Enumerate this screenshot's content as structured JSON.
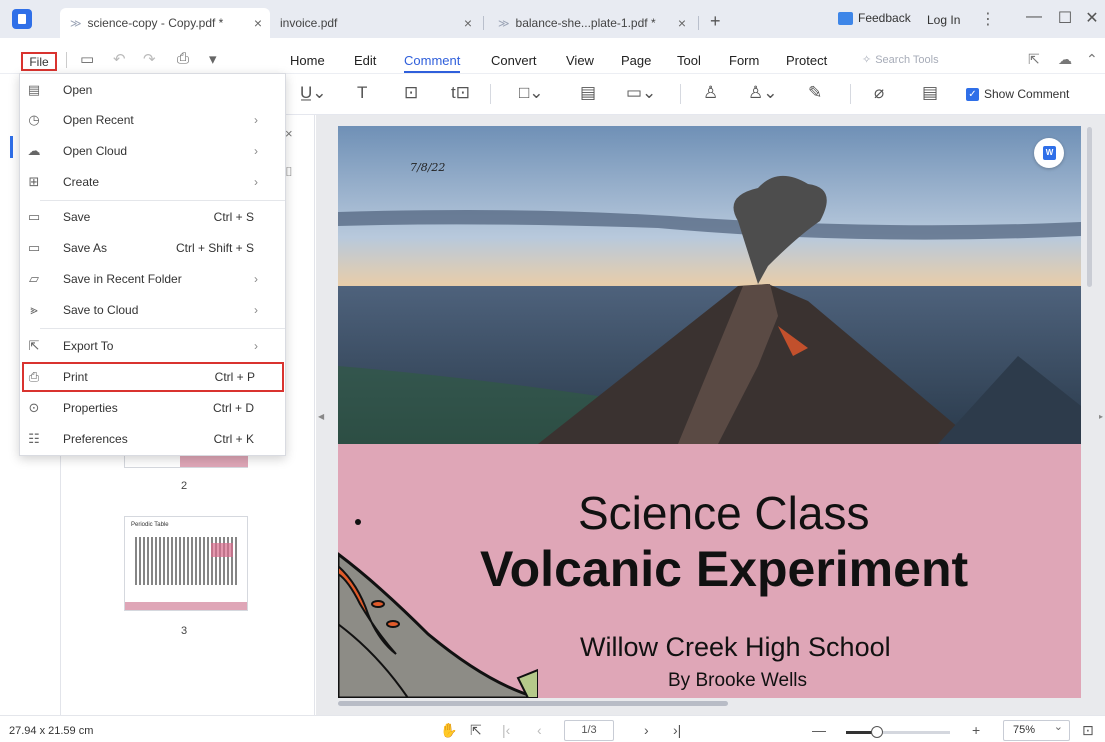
{
  "tabs": [
    {
      "label": "science-copy - Copy.pdf *",
      "close": "×"
    },
    {
      "label": "invoice.pdf",
      "close": "×"
    },
    {
      "label": "balance-she...plate-1.pdf *",
      "close": "×"
    }
  ],
  "tab_add": "+",
  "header": {
    "feedback": "Feedback",
    "login": "Log In",
    "kebab": "⋮",
    "minimize": "—",
    "maximize": "☐",
    "close": "✕"
  },
  "menu": {
    "file": "File",
    "items": [
      "Home",
      "Edit",
      "Comment",
      "Convert",
      "View",
      "Page",
      "Tool",
      "Form",
      "Protect"
    ],
    "active": "Comment",
    "search_placeholder": "Search Tools"
  },
  "toolbar": {
    "show_comment": "Show Comment",
    "show_comment_checked": true
  },
  "file_menu": [
    {
      "label": "Open",
      "shortcut": "",
      "arrow": false,
      "icon": "open-file-icon"
    },
    {
      "label": "Open Recent",
      "shortcut": "",
      "arrow": true,
      "icon": "clock-icon"
    },
    {
      "label": "Open Cloud",
      "shortcut": "",
      "arrow": true,
      "icon": "cloud-icon"
    },
    {
      "label": "Create",
      "shortcut": "",
      "arrow": true,
      "icon": "create-icon"
    },
    {
      "label": "Save",
      "shortcut": "Ctrl + S",
      "arrow": false,
      "icon": "save-icon"
    },
    {
      "label": "Save As",
      "shortcut": "Ctrl + Shift + S",
      "arrow": false,
      "icon": "save-as-icon"
    },
    {
      "label": "Save in Recent Folder",
      "shortcut": "",
      "arrow": true,
      "icon": "folder-icon"
    },
    {
      "label": "Save to Cloud",
      "shortcut": "",
      "arrow": true,
      "icon": "cloud-upload-icon"
    },
    {
      "label": "Export To",
      "shortcut": "",
      "arrow": true,
      "icon": "export-icon"
    },
    {
      "label": "Print",
      "shortcut": "Ctrl + P",
      "arrow": false,
      "icon": "printer-icon"
    },
    {
      "label": "Properties",
      "shortcut": "Ctrl + D",
      "arrow": false,
      "icon": "properties-icon"
    },
    {
      "label": "Preferences",
      "shortcut": "Ctrl + K",
      "arrow": false,
      "icon": "preferences-icon"
    }
  ],
  "thumbnails": {
    "page2": "2",
    "page3": "3",
    "page3_title": "Periodic Table"
  },
  "document": {
    "date": "7/8/22",
    "title_line1": "Science Class",
    "title_line2": "Volcanic Experiment",
    "school": "Willow Creek High School",
    "author": "By Brooke Wells",
    "pink_color": "#dfa6b7"
  },
  "status": {
    "dimensions": "27.94 x 21.59 cm",
    "page_indicator": "1/3",
    "zoom": "75%",
    "zoom_level": 0.3
  }
}
